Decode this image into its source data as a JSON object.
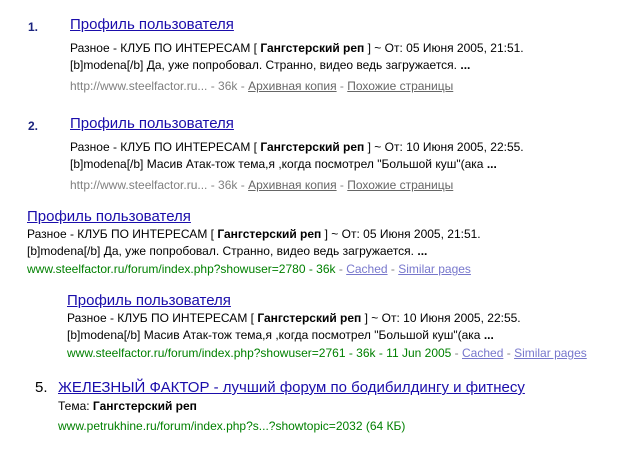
{
  "results": [
    {
      "number": "1.",
      "title": "Профиль пользователя",
      "line1_pre": "Разное - КЛУБ ПО ИНТЕРЕСАМ [ ",
      "line1_bold": "Гангстерский реп",
      "line1_post": " ] ~ От: 05 Июня 2005, 21:51.",
      "line2": "[b]modena[/b] Да, уже попробовал. Странно, видео ведь загружается.",
      "ellipsis": "...",
      "url": "http://www.steelfactor.ru...",
      "size": " - 36k - ",
      "cache_link": "Архивная копия",
      "sep": " - ",
      "similar_link": "Похожие страницы"
    },
    {
      "number": "2.",
      "title": "Профиль пользователя",
      "line1_pre": "Разное - КЛУБ ПО ИНТЕРЕСАМ [ ",
      "line1_bold": "Гангстерский реп",
      "line1_post": " ] ~ От: 10 Июня 2005, 22:55.",
      "line2": "[b]modena[/b] Масив Атак-тож тема,я ,когда посмотрел \"Большой куш\"(ака",
      "ellipsis": "...",
      "url": "http://www.steelfactor.ru...",
      "size": " - 36k - ",
      "cache_link": "Архивная копия",
      "sep": " - ",
      "similar_link": "Похожие страницы"
    },
    {
      "title": "Профиль пользователя",
      "line1_pre": "Разное - КЛУБ ПО ИНТЕРЕСАМ [ ",
      "line1_bold": "Гангстерский реп",
      "line1_post": " ] ~ От: 05 Июня 2005, 21:51.",
      "line2": "[b]modena[/b] Да, уже попробовал. Странно, видео ведь загружается.",
      "ellipsis": "...",
      "url": "www.steelfactor.ru/forum/index.php?showuser=2780 - 36k",
      "sep1": " - ",
      "cache_link": "Cached",
      "sep2": " - ",
      "similar_link": "Similar pages"
    },
    {
      "title": "Профиль пользователя",
      "line1_pre": "Разное - КЛУБ ПО ИНТЕРЕСАМ [ ",
      "line1_bold": "Гангстерский реп",
      "line1_post": " ] ~ От: 10 Июня 2005, 22:55.",
      "line2": "[b]modena[/b] Масив Атак-тож тема,я ,когда посмотрел \"Большой куш\"(ака",
      "ellipsis": "...",
      "url": "www.steelfactor.ru/forum/index.php?showuser=2761 - 36k - 11 Jun 2005",
      "sep1": " - ",
      "cache_link": "Cached",
      "sep2": " - ",
      "similar_link": "Similar pages"
    },
    {
      "number": "5.",
      "title": "ЖЕЛЕЗНЫЙ ФАКТОР - лучший форум по бодибилдингу и фитнесу",
      "topic_label": "Тема: ",
      "topic_bold": "Гангстерский реп",
      "url": "www.petrukhine.ru/forum/index.php?s...?showtopic=2032 (64 КБ)"
    }
  ]
}
